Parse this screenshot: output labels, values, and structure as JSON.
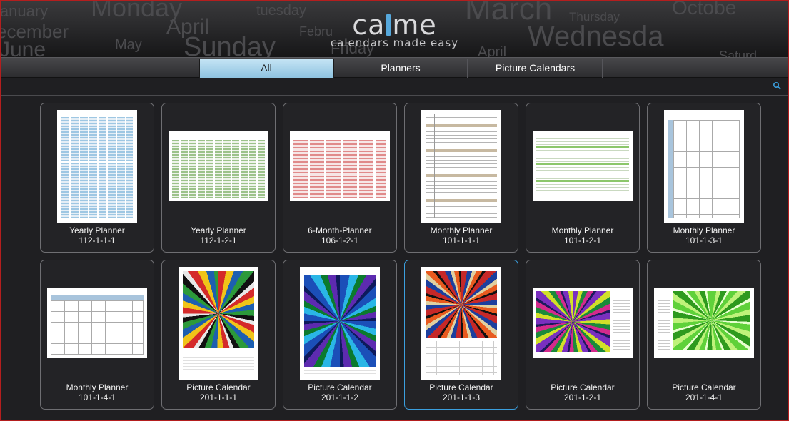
{
  "header": {
    "logo_left": "ca",
    "logo_right": "me",
    "tagline": "calendars made easy",
    "background_words": [
      "january",
      "Monday",
      "tuesday",
      "March",
      "Octobe",
      "ecember",
      "April",
      "Febru",
      "Thursday",
      "Wednesda",
      "June",
      "May",
      "Sunday",
      "Friday",
      "April",
      "Saturd"
    ]
  },
  "tabs": [
    {
      "label": "All",
      "active": true
    },
    {
      "label": "Planners",
      "active": false
    },
    {
      "label": "Picture Calendars",
      "active": false
    }
  ],
  "search": {
    "icon": "search-icon"
  },
  "colors": {
    "accent": "#56a8dc",
    "tab_active": "#a9d6ee",
    "selected_border": "#3b9fde",
    "background": "#1f1f22"
  },
  "items": [
    {
      "title": "Yearly Planner",
      "code": "112-1-1-1",
      "thumb": "yearly-blue"
    },
    {
      "title": "Yearly Planner",
      "code": "112-1-2-1",
      "thumb": "yearly-green"
    },
    {
      "title": "6-Month-Planner",
      "code": "106-1-2-1",
      "thumb": "sixmonth-red"
    },
    {
      "title": "Monthly Planner",
      "code": "101-1-1-1",
      "thumb": "monthly-list"
    },
    {
      "title": "Monthly Planner",
      "code": "101-1-2-1",
      "thumb": "monthly-green"
    },
    {
      "title": "Monthly Planner",
      "code": "101-1-3-1",
      "thumb": "monthly-grid-portrait"
    },
    {
      "title": "Monthly Planner",
      "code": "101-1-4-1",
      "thumb": "monthly-grid-landscape"
    },
    {
      "title": "Picture Calendar",
      "code": "201-1-1-1",
      "thumb": "picture-star"
    },
    {
      "title": "Picture Calendar",
      "code": "201-1-1-2",
      "thumb": "picture-kaleido-blue"
    },
    {
      "title": "Picture Calendar",
      "code": "201-1-1-3",
      "thumb": "picture-kaleido-red",
      "selected": true
    },
    {
      "title": "Picture Calendar",
      "code": "201-1-2-1",
      "thumb": "picture-kaleido-purple"
    },
    {
      "title": "Picture Calendar",
      "code": "201-1-4-1",
      "thumb": "picture-kaleido-green"
    }
  ]
}
